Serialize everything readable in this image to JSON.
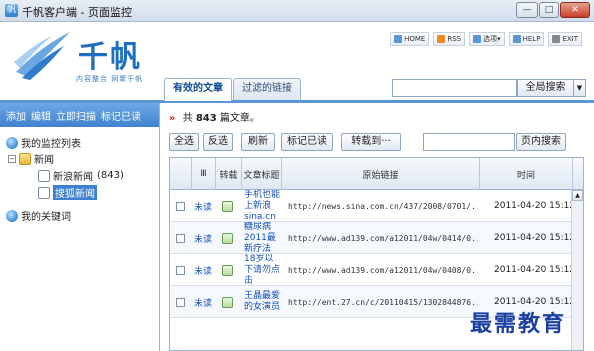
{
  "window": {
    "title": "千帆客户端 - 页面监控",
    "app_icon": "app-icon",
    "controls": [
      "—",
      "□",
      "✕"
    ]
  },
  "brand": {
    "name": "千帆",
    "slogan": "内容整合 网聚千帆"
  },
  "top_links": [
    {
      "label": "HOME",
      "icon": "home-icon",
      "color": "#5b97d6"
    },
    {
      "label": "RSS",
      "icon": "rss-icon",
      "color": "#f08a24"
    },
    {
      "label": "选项▾",
      "icon": "options-icon",
      "color": "#5b97d6"
    },
    {
      "label": "HELP",
      "icon": "help-icon",
      "color": "#5b97d6"
    },
    {
      "label": "EXIT",
      "icon": "exit-icon",
      "color": "#888888"
    }
  ],
  "tabs": [
    {
      "label": "有效的文章",
      "active": true
    },
    {
      "label": "过滤的链接",
      "active": false
    }
  ],
  "global_search": {
    "button_label": "全局搜索",
    "value": ""
  },
  "sidebar": {
    "toolbar": [
      "添加",
      "编辑",
      "立即扫描",
      "标记已读"
    ],
    "tree": {
      "monitor_list": "我的监控列表",
      "news_folder": "新闻",
      "sina_news": "新浪新闻",
      "sina_count": "(843)",
      "sohu_news": "搜狐新闻",
      "keywords": "我的关键词"
    }
  },
  "content": {
    "count_prefix": "共",
    "count": "843",
    "count_suffix": "篇文章。",
    "buttons": [
      "全选",
      "反选",
      "刷新",
      "标记已读",
      "转载到···"
    ],
    "page_search_label": "页内搜索",
    "columns": [
      "",
      "",
      "转载",
      "文章标题",
      "原始链接",
      "时间"
    ],
    "rows": [
      {
        "status": "未读",
        "title": "手机也能上新浪sina.cn",
        "url": "http://news.sina.com.cn/437/2008/0701/...",
        "time": "2011-04-20 15:12"
      },
      {
        "status": "未读",
        "title": "糖尿病2011最新疗法",
        "url": "http://www.ad139.com/a12011/04w/0414/0...",
        "time": "2011-04-20 15:12"
      },
      {
        "status": "未读",
        "title": "18岁以下请勿点击",
        "url": "http://www.ad139.com/a12011/04w/0408/0...",
        "time": "2011-04-20 15:12"
      },
      {
        "status": "未读",
        "title": "王晶最爱的女演员",
        "url": "http://ent.27.cn/c/20110415/1302844876...",
        "time": "2011-04-20 15:12"
      }
    ]
  },
  "watermark": "最需教育"
}
